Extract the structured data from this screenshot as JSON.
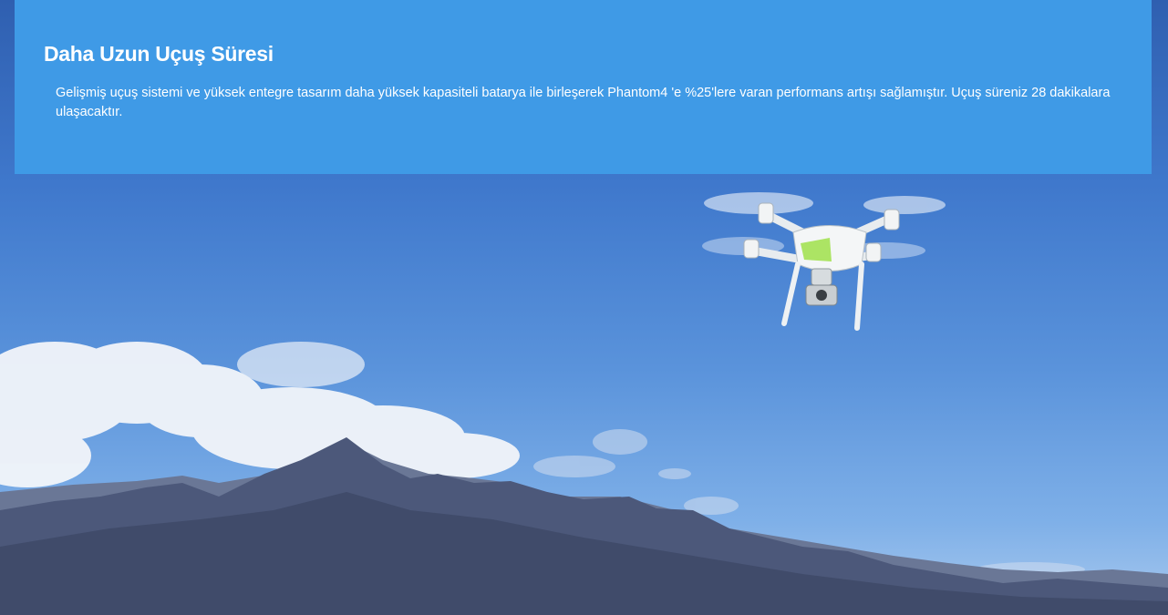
{
  "banner": {
    "title": "Daha Uzun Uçuş Süresi",
    "description": "Gelişmiş uçuş sistemi ve yüksek entegre tasarım daha yüksek kapasiteli batarya ile birleşerek Phantom4 'e %25'lere varan performans artışı sağlamıştır. Uçuş süreniz 28 dakikalara ulaşacaktır."
  },
  "colors": {
    "banner_background": "#3f9ae6",
    "sky_top": "#2f5fb0",
    "sky_bottom": "#a9c9ee",
    "text": "#ffffff"
  }
}
